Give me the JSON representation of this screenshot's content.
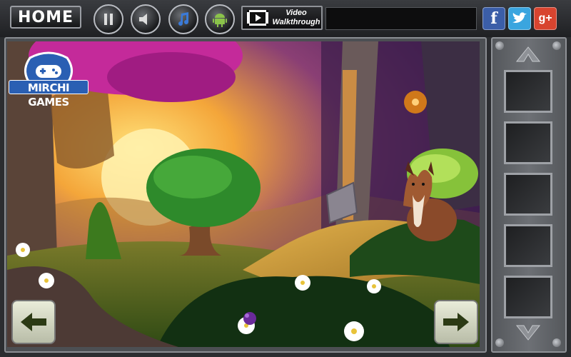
{
  "toolbar": {
    "home_label": "HOME",
    "video_label_line1": "Video",
    "video_label_line2": "Walkthrough"
  },
  "social": {
    "facebook": "f",
    "twitter": "t",
    "googleplus": "g+"
  },
  "logo": {
    "text": "MIRCHI GAMES"
  },
  "inventory": {
    "slot_count": 5
  },
  "colors": {
    "sky_purple": "#5a2a78",
    "sun_yellow": "#ffd45a",
    "foliage_green": "#2e8a2b",
    "pink_leaves": "#c42a9a"
  }
}
